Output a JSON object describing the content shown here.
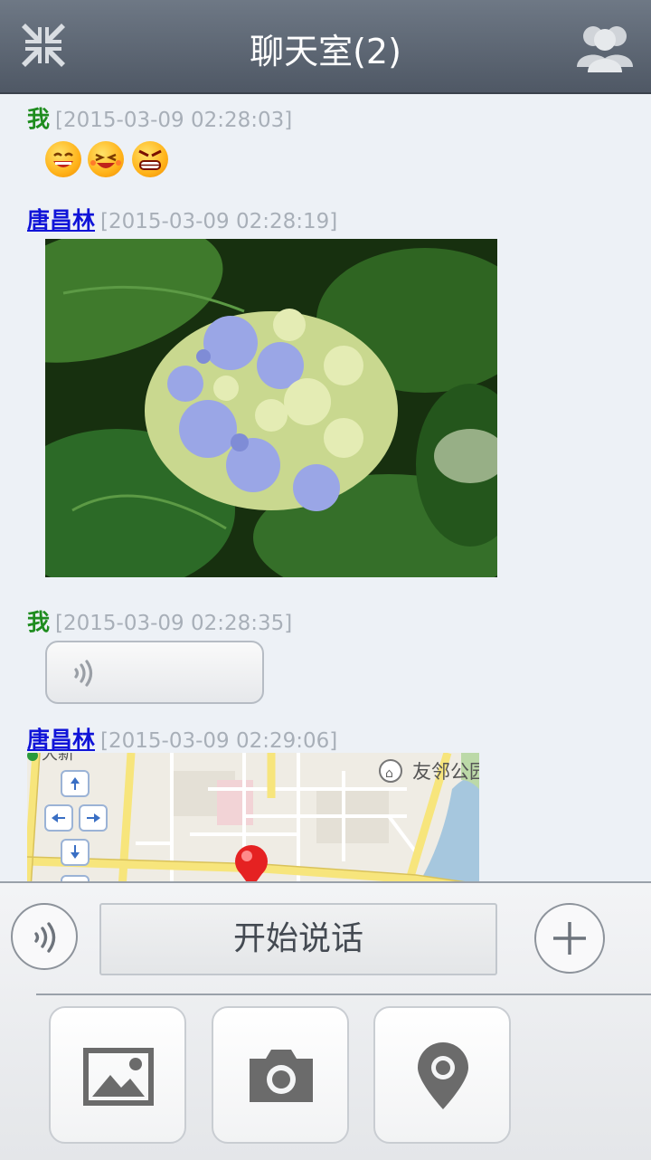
{
  "header": {
    "title": "聊天室(2)"
  },
  "messages": [
    {
      "sender": "我",
      "time": "[2015-03-09 02:28:03]",
      "type": "emoji"
    },
    {
      "sender": "唐昌林",
      "time": "[2015-03-09 02:28:19]",
      "type": "image"
    },
    {
      "sender": "我",
      "time": "[2015-03-09 02:28:35]",
      "type": "voice"
    },
    {
      "sender": "唐昌林",
      "time": "[2015-03-09 02:29:06]",
      "type": "location"
    }
  ],
  "map": {
    "poi_label": "友邻公园",
    "top_label": "大新"
  },
  "input": {
    "talk_label": "开始说话"
  },
  "tools": [
    "image-icon",
    "camera-icon",
    "location-pin-icon"
  ],
  "colors": {
    "me_name": "#1e8c1e",
    "other_name": "#1014d8",
    "timestamp": "#a8afb8"
  }
}
